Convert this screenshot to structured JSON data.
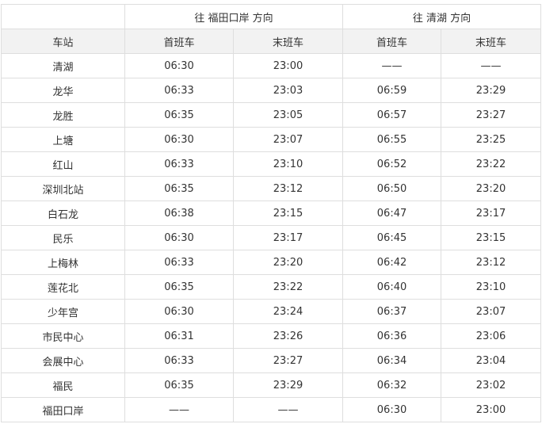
{
  "header": {
    "dir1": "往 福田口岸 方向",
    "dir2": "往 清湖 方向",
    "station": "车站",
    "first": "首班车",
    "last": "末班车"
  },
  "rows": [
    [
      "清湖",
      "06:30",
      "23:00",
      "——",
      "——"
    ],
    [
      "龙华",
      "06:33",
      "23:03",
      "06:59",
      "23:29"
    ],
    [
      "龙胜",
      "06:35",
      "23:05",
      "06:57",
      "23:27"
    ],
    [
      "上塘",
      "06:30",
      "23:07",
      "06:55",
      "23:25"
    ],
    [
      "红山",
      "06:33",
      "23:10",
      "06:52",
      "23:22"
    ],
    [
      "深圳北站",
      "06:35",
      "23:12",
      "06:50",
      "23:20"
    ],
    [
      "白石龙",
      "06:38",
      "23:15",
      "06:47",
      "23:17"
    ],
    [
      "民乐",
      "06:30",
      "23:17",
      "06:45",
      "23:15"
    ],
    [
      "上梅林",
      "06:33",
      "23:20",
      "06:42",
      "23:12"
    ],
    [
      "莲花北",
      "06:35",
      "23:22",
      "06:40",
      "23:10"
    ],
    [
      "少年宫",
      "06:30",
      "23:24",
      "06:37",
      "23:07"
    ],
    [
      "市民中心",
      "06:31",
      "23:26",
      "06:36",
      "23:06"
    ],
    [
      "会展中心",
      "06:33",
      "23:27",
      "06:34",
      "23:04"
    ],
    [
      "福民",
      "06:35",
      "23:29",
      "06:32",
      "23:02"
    ],
    [
      "福田口岸",
      "——",
      "——",
      "06:30",
      "23:00"
    ]
  ]
}
